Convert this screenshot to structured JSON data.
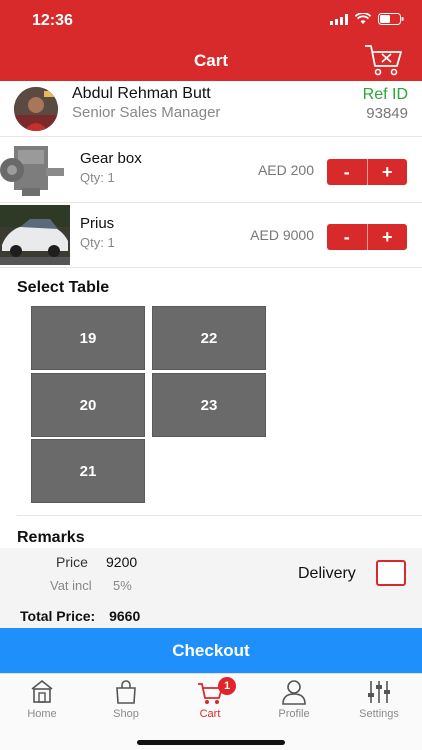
{
  "status_bar": {
    "time": "12:36"
  },
  "header": {
    "title": "Cart"
  },
  "profile": {
    "name": "Abdul Rehman Butt",
    "role": "Senior Sales Manager",
    "ref_label": "Ref ID",
    "ref_value": "93849"
  },
  "cart_items": [
    {
      "name": "Gear box",
      "qty": "Qty: 1",
      "price": "AED 200",
      "minus": "-",
      "plus": "+"
    },
    {
      "name": "Prius",
      "qty": "Qty: 1",
      "price": "AED 9000",
      "minus": "-",
      "plus": "+"
    }
  ],
  "select_table": {
    "title": "Select Table",
    "tables": [
      "19",
      "22",
      "20",
      "23",
      "21"
    ]
  },
  "remarks": {
    "title": "Remarks"
  },
  "summary": {
    "price_label": "Price",
    "price_value": "9200",
    "vat_label": "Vat incl",
    "vat_value": "5%",
    "delivery_label": "Delivery",
    "total_label": "Total Price:",
    "total_value": "9660"
  },
  "checkout_label": "Checkout",
  "tabbar": {
    "tabs": [
      {
        "label": "Home",
        "icon": "home-icon"
      },
      {
        "label": "Shop",
        "icon": "shopping-bag-icon"
      },
      {
        "label": "Cart",
        "icon": "cart-icon",
        "badge": "1"
      },
      {
        "label": "Profile",
        "icon": "profile-icon"
      },
      {
        "label": "Settings",
        "icon": "sliders-icon"
      }
    ],
    "active": "Cart"
  },
  "colors": {
    "primary_red": "#d82a2a",
    "checkout_blue": "#1f8ffb",
    "ref_green": "#2aa63a",
    "table_gray": "#6a6a6a"
  }
}
